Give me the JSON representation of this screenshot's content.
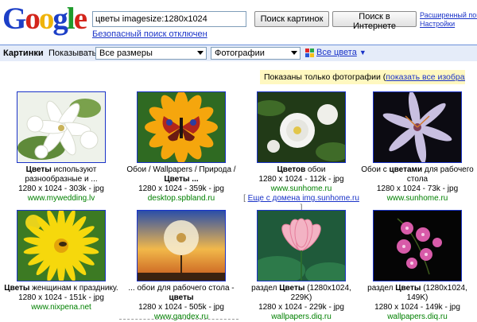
{
  "logo": {
    "text": "Google",
    "letters": [
      {
        "ch": "G",
        "color": "#1c3fc7"
      },
      {
        "ch": "o",
        "color": "#d3251b"
      },
      {
        "ch": "o",
        "color": "#efb30a"
      },
      {
        "ch": "g",
        "color": "#1c3fc7"
      },
      {
        "ch": "l",
        "color": "#1f9b2c"
      },
      {
        "ch": "e",
        "color": "#d3251b"
      }
    ]
  },
  "search": {
    "value": "цветы imagesize:1280x1024"
  },
  "buttons": {
    "search_images": "Поиск картинок",
    "search_web": "Поиск в Интернете"
  },
  "safe_search": "Безопасный поиск отключен",
  "advanced": {
    "line1": "Расширенный поиск",
    "line2": "Настройки"
  },
  "filter_bar": {
    "section": "Картинки",
    "show_label": "Показывать:",
    "size_value": "Все размеры",
    "type_value": "Фотографии",
    "colors_label": "Все цвета",
    "color_squares": [
      "#e0262a",
      "#27a844",
      "#2a56d6",
      "#f4c018"
    ]
  },
  "notice": {
    "text": "Показаны только фотографии (",
    "link": "показать все изображения",
    "end": ")"
  },
  "results": [
    {
      "cap_pre": "",
      "cap_bold": "Цветы",
      "cap_post": " используют разнообразные и ...",
      "meta": "1280 x 1024 - 303k - jpg",
      "url": "www.mywedding.lv",
      "kind": "lily"
    },
    {
      "cap_pre": "Обои / Wallpapers / Природа / ",
      "cap_bold": "Цветы ...",
      "cap_post": "",
      "meta": "1280 x 1024 - 359k - jpg",
      "url": "desktop.spbland.ru",
      "kind": "butterfly"
    },
    {
      "cap_pre": "",
      "cap_bold": "Цветов",
      "cap_post": " обои",
      "meta": "1280 x 1024 - 112k - jpg",
      "url": "www.sunhome.ru",
      "more_pre": "[ ",
      "more": "Еще с домена img.sunhome.ru",
      "more_post": " ]",
      "kind": "rose"
    },
    {
      "cap_pre": "Обои с ",
      "cap_bold": "цветами",
      "cap_post": " для рабочего стола",
      "meta": "1280 x 1024 - 73k - jpg",
      "url": "www.sunhome.ru",
      "kind": "darklily"
    },
    {
      "cap_pre": "",
      "cap_bold": "Цветы",
      "cap_post": " женщинам к празднику.",
      "meta": "1280 x 1024 - 151k - jpg",
      "url": "www.nixpena.net",
      "kind": "dandelion"
    },
    {
      "cap_pre": "... обои для рабочего стола - ",
      "cap_bold": "цветы",
      "cap_post": "",
      "meta": "1280 x 1024 - 505k - jpg",
      "url": "www.gandex.ru",
      "kind": "seeds"
    },
    {
      "cap_pre": "раздел ",
      "cap_bold": "Цветы",
      "cap_post": " (1280x1024, 229K)",
      "meta": "1280 x 1024 - 229k - jpg",
      "url": "wallpapers.diq.ru",
      "kind": "lotus"
    },
    {
      "cap_pre": "раздел ",
      "cap_bold": "Цветы",
      "cap_post": " (1280x1024, 149K)",
      "meta": "1280 x 1024 - 149k - jpg",
      "url": "wallpapers.diq.ru",
      "kind": "orchid"
    }
  ]
}
